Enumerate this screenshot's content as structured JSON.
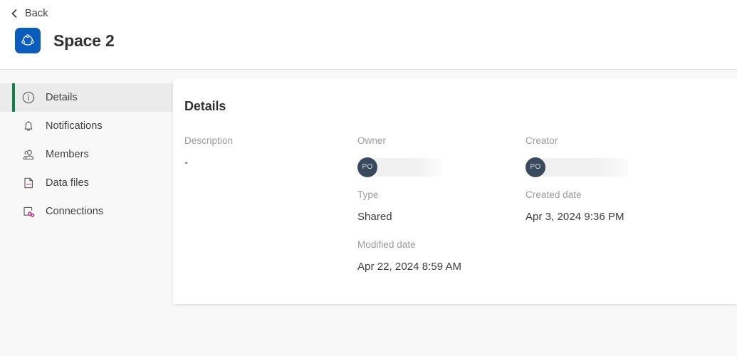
{
  "header": {
    "back_label": "Back",
    "back_icon": "chevron-left-icon",
    "space_icon": "space-hub-icon",
    "space_title": "Space 2",
    "brand_color": "#0a5dbd"
  },
  "sidebar": {
    "active_accent_color": "#118145",
    "items": [
      {
        "id": "details",
        "label": "Details",
        "icon": "info-circle-icon",
        "active": true
      },
      {
        "id": "notifications",
        "label": "Notifications",
        "icon": "bell-icon",
        "active": false
      },
      {
        "id": "members",
        "label": "Members",
        "icon": "members-icon",
        "active": false
      },
      {
        "id": "data-files",
        "label": "Data files",
        "icon": "file-document-icon",
        "active": false
      },
      {
        "id": "connections",
        "label": "Connections",
        "icon": "connections-icon",
        "active": false
      }
    ]
  },
  "main": {
    "title": "Details",
    "fields": {
      "description": {
        "label": "Description",
        "value": "-"
      },
      "owner": {
        "label": "Owner",
        "avatar_initials": "PO",
        "avatar_color": "#3a4a5e",
        "value_redacted": true
      },
      "creator": {
        "label": "Creator",
        "avatar_initials": "PO",
        "avatar_color": "#3a4a5e",
        "value_redacted": true
      },
      "type": {
        "label": "Type",
        "value": "Shared"
      },
      "created_date": {
        "label": "Created date",
        "value": "Apr 3, 2024 9:36 PM"
      },
      "modified_date": {
        "label": "Modified date",
        "value": "Apr 22, 2024 8:59 AM"
      }
    }
  }
}
